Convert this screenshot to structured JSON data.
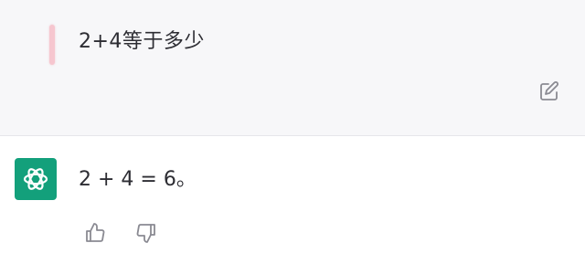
{
  "user_message": {
    "text": "2+4等于多少"
  },
  "assistant_message": {
    "text": "2 + 4 = 6。"
  },
  "icons": {
    "edit": "edit-icon",
    "avatar": "openai-logo-icon",
    "thumb_up": "thumbs-up-icon",
    "thumb_down": "thumbs-down-icon"
  },
  "colors": {
    "avatar_bg": "#13a07b",
    "user_marker": "#f6c6cf",
    "user_bg": "#f7f7f9"
  }
}
